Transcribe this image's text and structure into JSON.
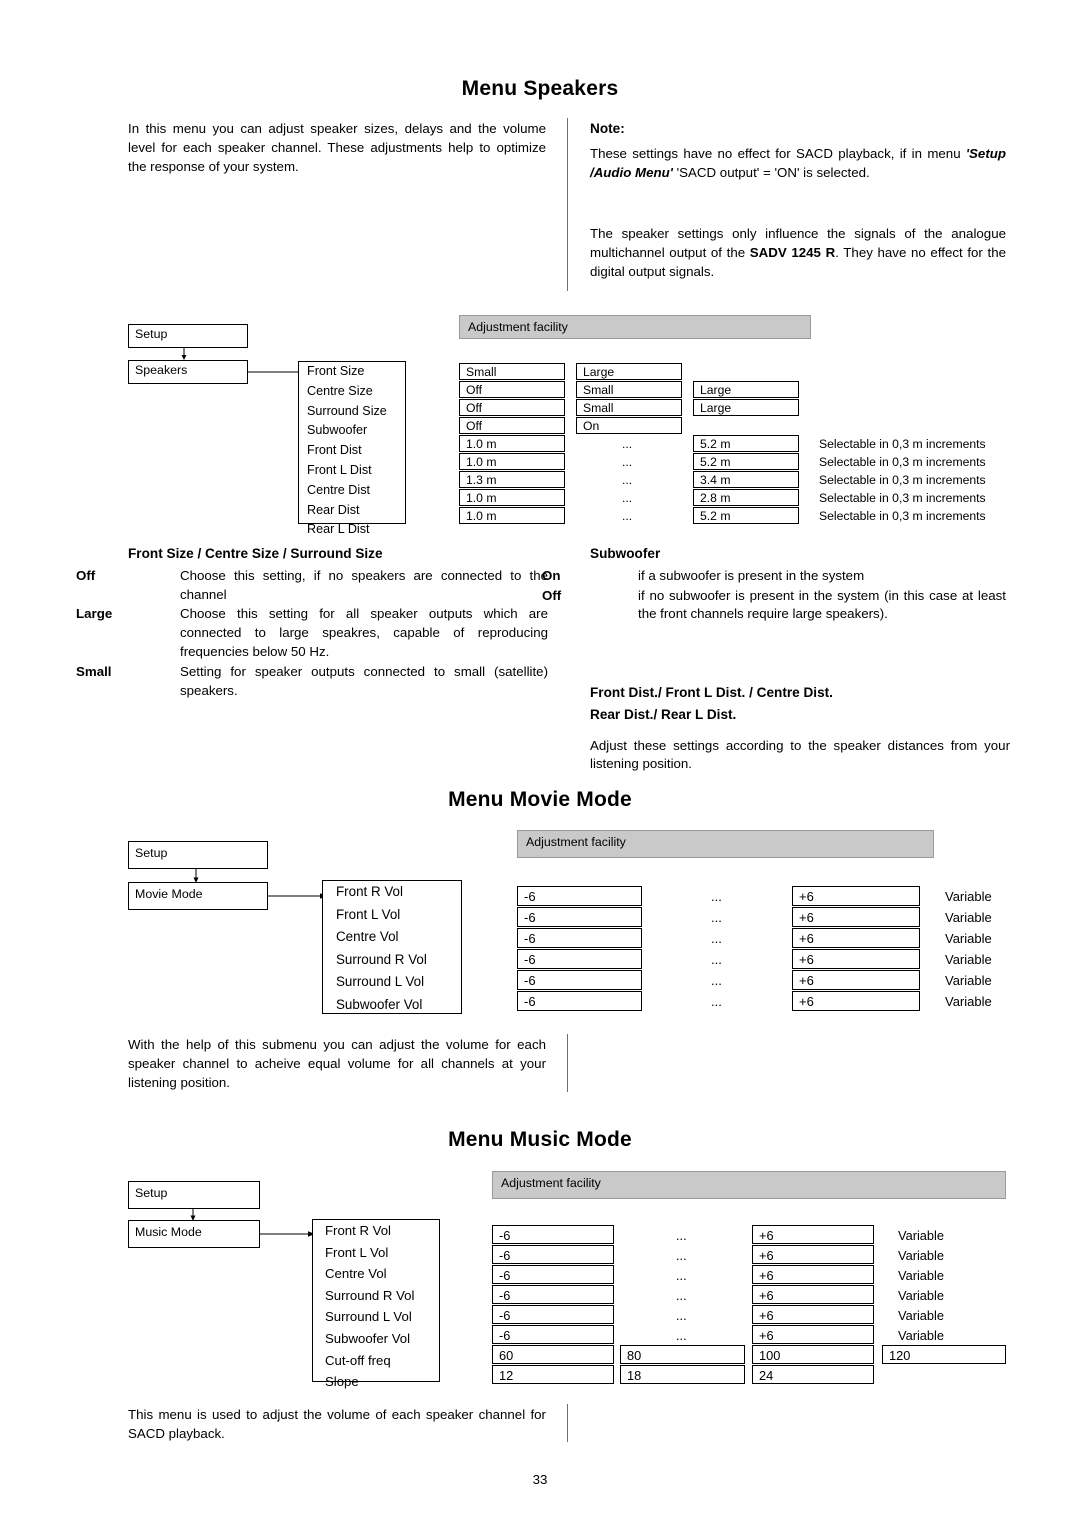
{
  "sections": {
    "speakers_title": "Menu Speakers",
    "movie_title": "Menu Movie Mode",
    "music_title": "Menu Music Mode"
  },
  "intro": {
    "speakers": "In this menu you can adjust speaker sizes, delays and the volume level for each speaker channel. These adjustments help to optimize the response of your system."
  },
  "note": {
    "heading": "Note:",
    "p1_a": "These settings have no effect for SACD playback, if in menu ",
    "p1_menu": "'Setup /Audio Menu'",
    "p1_b": " 'SACD output' = 'ON' is selected.",
    "p2_a": "The speaker settings only influence the signals of the analogue multichannel output of the ",
    "p2_model": "SADV 1245 R",
    "p2_b": ". They have no effect for the digital output signals."
  },
  "diagram_speakers": {
    "adjustment_label": "Adjustment facility",
    "setup": "Setup",
    "menu": "Speakers",
    "items": [
      "Front Size",
      "Centre Size",
      "Surround Size",
      "Subwoofer",
      "Front Dist",
      "Front L Dist",
      "Centre Dist",
      "Rear Dist",
      "Rear L Dist"
    ],
    "col1": [
      "Small",
      "Off",
      "Off",
      "Off",
      "1.0 m",
      "1.0 m",
      "1.3 m",
      "1.0 m",
      "1.0 m"
    ],
    "col2": [
      "Large",
      "Small",
      "Small",
      "On",
      "...",
      "...",
      "...",
      "...",
      "..."
    ],
    "col3": [
      "",
      "Large",
      "Large",
      "",
      "5.2 m",
      "5.2 m",
      "3.4 m",
      "2.8 m",
      "5.2 m"
    ],
    "notes": [
      "Selectable in 0,3 m increments",
      "Selectable in 0,3 m increments",
      "Selectable in 0,3 m increments",
      "Selectable in 0,3 m increments",
      "Selectable in 0,3 m increments"
    ]
  },
  "defs_left": {
    "heading": "Front Size / Centre Size / Surround Size",
    "rows": [
      {
        "term": "Off",
        "text": "Choose this setting, if no speakers are connected to the channel"
      },
      {
        "term": "Large",
        "text": "Choose this setting for all speaker outputs which are connected to large speakres, capable of reproducing frequencies below 50 Hz."
      },
      {
        "term": "Small",
        "text": "Setting for speaker outputs connected to small (satellite) speakers."
      }
    ]
  },
  "defs_right": {
    "heading": "Subwoofer",
    "rows": [
      {
        "term": "On",
        "text": "if a subwoofer is present in the system"
      },
      {
        "term": "Off",
        "text": "if no subwoofer is present in the system (in this case at least the front channels require large speakers)."
      }
    ],
    "dist_heading_1": "Front Dist./ Front L Dist. / Centre Dist.",
    "dist_heading_2": "Rear Dist./ Rear L Dist.",
    "dist_text": "Adjust these settings according to the speaker distances from your listening position."
  },
  "diagram_movie": {
    "adjustment_label": "Adjustment facility",
    "setup": "Setup",
    "menu": "Movie Mode",
    "items": [
      "Front R Vol",
      "Front L Vol",
      "Centre Vol",
      "Surround R Vol",
      "Surround L Vol",
      "Subwoofer Vol"
    ],
    "col1": [
      "-6",
      "-6",
      "-6",
      "-6",
      "-6",
      "-6"
    ],
    "col2": [
      "...",
      "...",
      "...",
      "...",
      "...",
      "..."
    ],
    "col3": [
      "+6",
      "+6",
      "+6",
      "+6",
      "+6",
      "+6"
    ],
    "notes": [
      "Variable",
      "Variable",
      "Variable",
      "Variable",
      "Variable",
      "Variable"
    ]
  },
  "movie_text": "With the help of this submenu you can adjust the volume for each speaker channel to acheive equal volume for all channels at your listening position.",
  "diagram_music": {
    "adjustment_label": "Adjustment facility",
    "setup": "Setup",
    "menu": "Music Mode",
    "items": [
      "Front R Vol",
      "Front L Vol",
      "Centre Vol",
      "Surround R Vol",
      "Surround L Vol",
      "Subwoofer Vol",
      "Cut-off freq",
      "Slope"
    ],
    "col1": [
      "-6",
      "-6",
      "-6",
      "-6",
      "-6",
      "-6",
      "60",
      "12"
    ],
    "col2": [
      "...",
      "...",
      "...",
      "...",
      "...",
      "...",
      "80",
      "18"
    ],
    "col3": [
      "+6",
      "+6",
      "+6",
      "+6",
      "+6",
      "+6",
      "100",
      "24"
    ],
    "col4": [
      "",
      "",
      "",
      "",
      "",
      "",
      "120",
      ""
    ],
    "notes": [
      "Variable",
      "Variable",
      "Variable",
      "Variable",
      "Variable",
      "Variable",
      "",
      ""
    ]
  },
  "music_text": "This menu is used to adjust the volume of each speaker channel for SACD playback.",
  "page_number": "33"
}
